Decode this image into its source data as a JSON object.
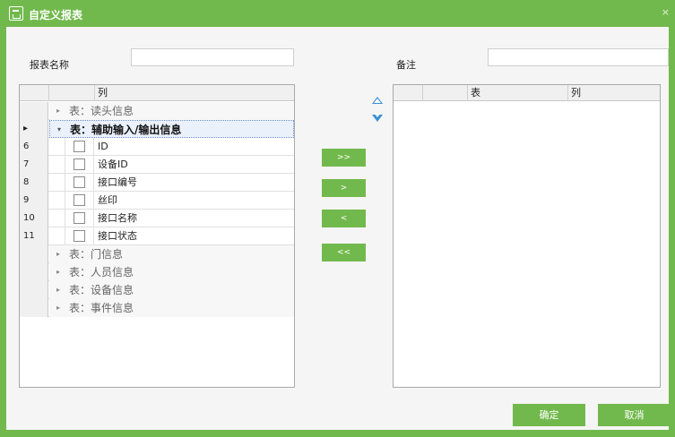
{
  "window": {
    "title": "自定义报表",
    "close_glyph": "×",
    "title_icon": "report-icon",
    "accent_color": "#72b94d"
  },
  "form": {
    "report_name_label": "报表名称",
    "report_name_value": "",
    "remark_label": "备注",
    "remark_value": ""
  },
  "left_grid": {
    "column_header": "列",
    "groups_before": [
      {
        "label": "表：读头信息",
        "expanded": false
      }
    ],
    "active_group": {
      "label": "表：辅助输入/输出信息",
      "expanded": true,
      "row_marker": "▸"
    },
    "rows": [
      {
        "num": "6",
        "name": "ID",
        "checked": false
      },
      {
        "num": "7",
        "name": "设备ID",
        "checked": false
      },
      {
        "num": "8",
        "name": "接口编号",
        "checked": false
      },
      {
        "num": "9",
        "name": "丝印",
        "checked": false
      },
      {
        "num": "10",
        "name": "接口名称",
        "checked": false
      },
      {
        "num": "11",
        "name": "接口状态",
        "checked": false
      }
    ],
    "groups_after": [
      {
        "label": "表：门信息",
        "expanded": false
      },
      {
        "label": "表：人员信息",
        "expanded": false
      },
      {
        "label": "表：设备信息",
        "expanded": false
      },
      {
        "label": "表：事件信息",
        "expanded": false
      }
    ]
  },
  "move_buttons": {
    "add_all": ">>",
    "add_one": ">",
    "remove_one": "<",
    "remove_all": "<<"
  },
  "right_grid": {
    "table_header": "表",
    "column_header": "列"
  },
  "dialog_buttons": {
    "ok": "确定",
    "cancel": "取消"
  }
}
